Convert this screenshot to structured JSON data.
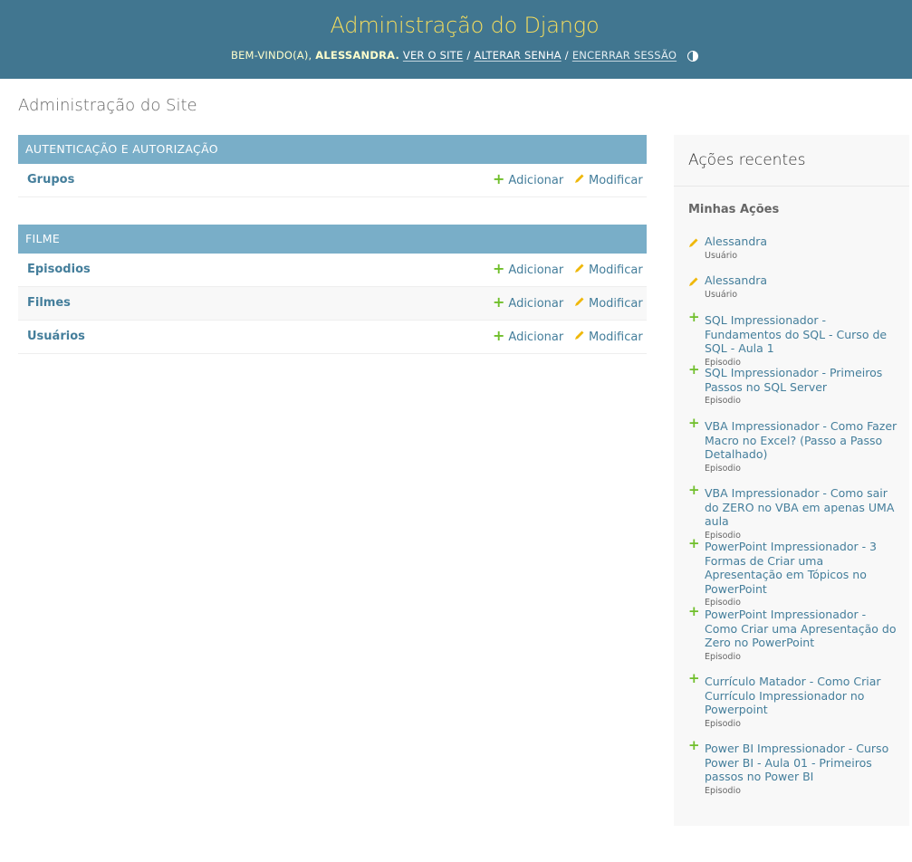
{
  "header": {
    "site_title": "Administração do Django",
    "welcome": "BEM-VINDO(A),",
    "username": "ALESSANDRA.",
    "view_site": "VER O SITE",
    "change_password": "ALTERAR SENHA",
    "logout": "ENCERRAR SESSÃO",
    "separator": "/"
  },
  "page_title": "Administração do Site",
  "modules": [
    {
      "caption": "AUTENTICAÇÃO E AUTORIZAÇÃO",
      "models": [
        {
          "name": "Grupos",
          "add": "Adicionar",
          "change": "Modificar"
        }
      ]
    },
    {
      "caption": "FILME",
      "models": [
        {
          "name": "Episodios",
          "add": "Adicionar",
          "change": "Modificar"
        },
        {
          "name": "Filmes",
          "add": "Adicionar",
          "change": "Modificar"
        },
        {
          "name": "Usuários",
          "add": "Adicionar",
          "change": "Modificar"
        }
      ]
    }
  ],
  "recent_actions": {
    "title": "Ações recentes",
    "subtitle": "Minhas Ações",
    "items": [
      {
        "icon": "pencil-icon",
        "label": "Alessandra",
        "type": "Usuário"
      },
      {
        "icon": "pencil-icon",
        "label": "Alessandra",
        "type": "Usuário"
      },
      {
        "icon": "plus-icon",
        "label": "SQL Impressionador - Fundamentos do SQL - Curso de SQL - Aula 1",
        "type": "Episodio"
      },
      {
        "icon": "plus-icon",
        "label": "SQL Impressionador - Primeiros Passos no SQL Server",
        "type": "Episodio"
      },
      {
        "icon": "plus-icon",
        "label": "VBA Impressionador - Como Fazer Macro no Excel? (Passo a Passo Detalhado)",
        "type": "Episodio"
      },
      {
        "icon": "plus-icon",
        "label": "VBA Impressionador - Como sair do ZERO no VBA em apenas UMA aula",
        "type": "Episodio"
      },
      {
        "icon": "plus-icon",
        "label": "PowerPoint Impressionador - 3 Formas de Criar uma Apresentação em Tópicos no PowerPoint",
        "type": "Episodio"
      },
      {
        "icon": "plus-icon",
        "label": "PowerPoint Impressionador - Como Criar uma Apresentação do Zero no PowerPoint",
        "type": "Episodio"
      },
      {
        "icon": "plus-icon",
        "label": "Currículo Matador - Como Criar Currículo Impressionador no Powerpoint",
        "type": "Episodio"
      },
      {
        "icon": "plus-icon",
        "label": "Power BI Impressionador - Curso Power BI - Aula 01 - Primeiros passos no Power BI",
        "type": "Episodio"
      }
    ]
  },
  "colors": {
    "header_bg": "#417690",
    "title_yellow": "#f5dd5d",
    "module_caption_bg": "#79aec8",
    "link": "#447e9b",
    "add_green": "#70bf2b",
    "change_yellow": "#efb80b"
  }
}
